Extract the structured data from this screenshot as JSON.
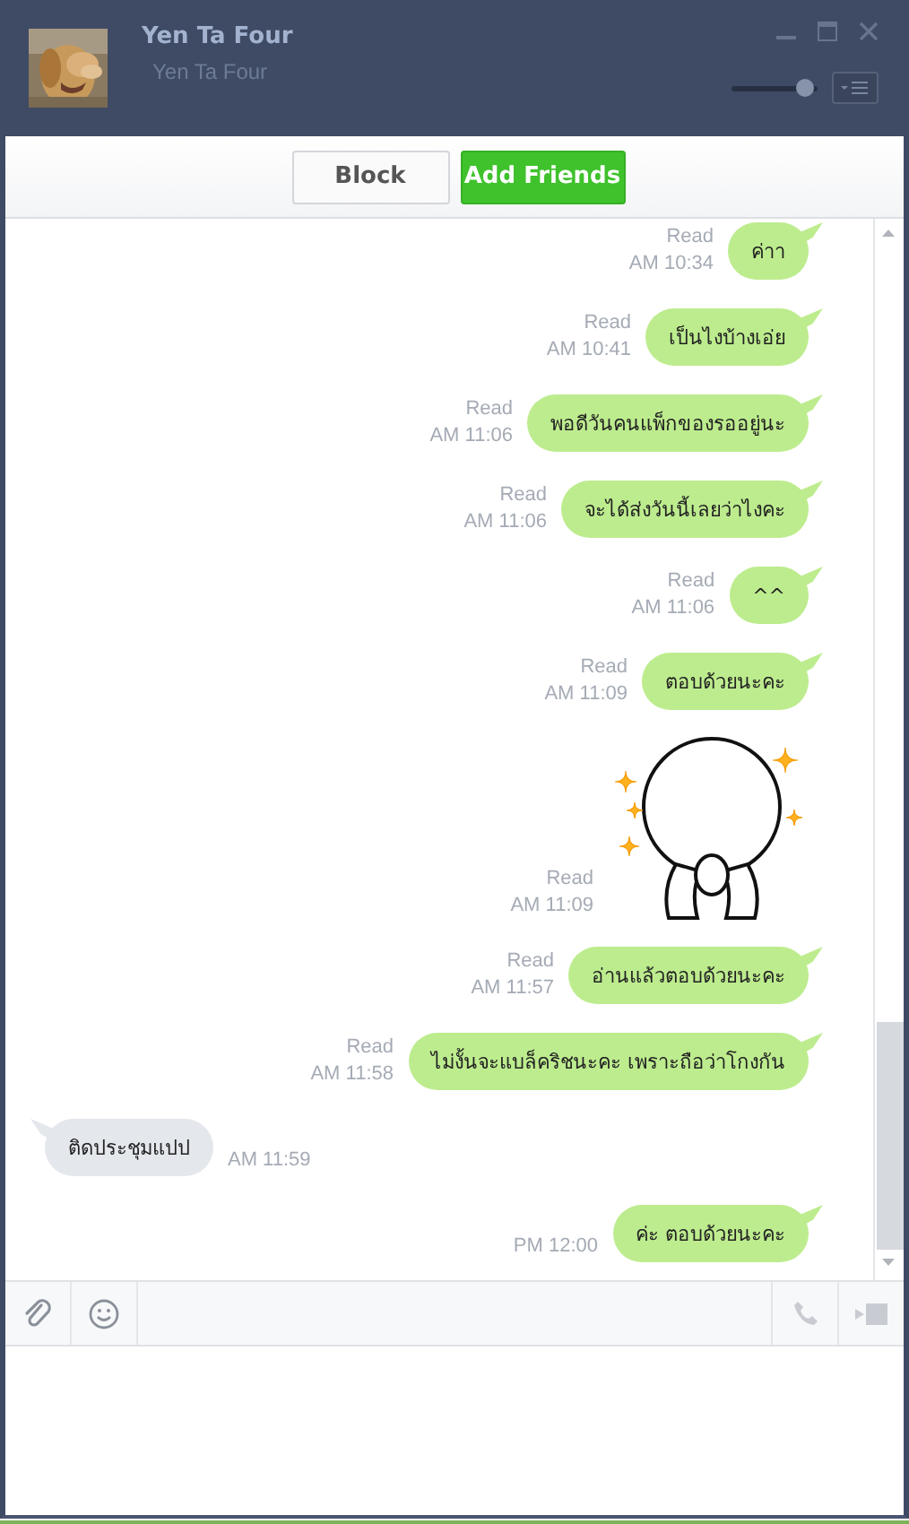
{
  "contact": {
    "name": "Yen Ta Four",
    "subtitle": "Yen Ta Four"
  },
  "volume": {
    "level": 0.85
  },
  "actions": [
    {
      "label": "Block",
      "kind": "plain"
    },
    {
      "label": "Add Friends",
      "kind": "primary"
    }
  ],
  "messages": [
    {
      "kind": "sent",
      "text": "ค่าา",
      "read_label": "Read",
      "time": "AM 10:34"
    },
    {
      "kind": "sent",
      "text": "เป็นไงบ้างเอ่ย",
      "read_label": "Read",
      "time": "AM 10:41"
    },
    {
      "kind": "sent",
      "text": "พอดีวันคนแพ็กของรออยู่นะ",
      "read_label": "Read",
      "time": "AM 11:06"
    },
    {
      "kind": "sent",
      "text": "จะได้ส่งวันนี้เลยว่าไงคะ",
      "read_label": "Read",
      "time": "AM 11:06"
    },
    {
      "kind": "sent",
      "text": "^^",
      "read_label": "Read",
      "time": "AM 11:06"
    },
    {
      "kind": "sent",
      "text": "ตอบด้วยนะคะ",
      "read_label": "Read",
      "time": "AM 11:09"
    },
    {
      "kind": "sticker",
      "read_label": "Read",
      "time": "AM 11:09"
    },
    {
      "kind": "sent",
      "text": "อ่านแล้วตอบด้วยนะคะ",
      "read_label": "Read",
      "time": "AM 11:57"
    },
    {
      "kind": "sent",
      "text": "ไม่งั้นจะแบล็คริชนะคะ เพราะถือว่าโกงกัน",
      "read_label": "Read",
      "time": "AM 11:58"
    },
    {
      "kind": "received",
      "text": "ติดประชุมแปป",
      "time": "AM 11:59"
    },
    {
      "kind": "sent",
      "text": "ค่ะ ตอบด้วยนะคะ",
      "time": "PM 12:00"
    }
  ]
}
